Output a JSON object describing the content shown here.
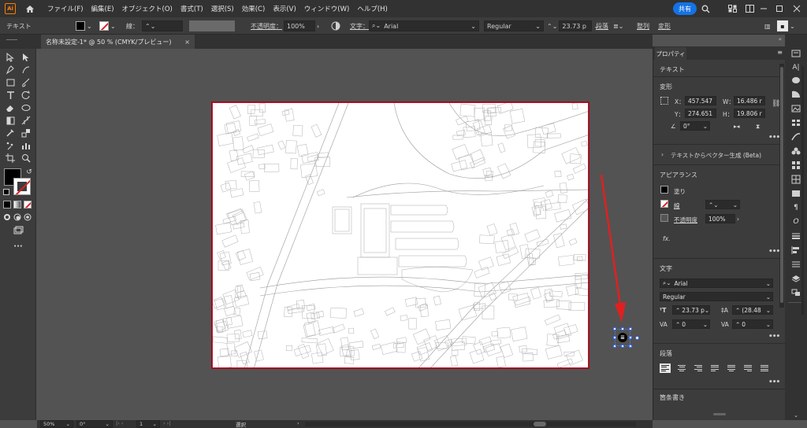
{
  "app": {
    "logo": "Ai",
    "menu": [
      "ファイル(F)",
      "編集(E)",
      "オブジェクト(O)",
      "書式(T)",
      "選択(S)",
      "効果(C)",
      "表示(V)",
      "ウィンドウ(W)",
      "ヘルプ(H)"
    ],
    "share_label": "共有"
  },
  "control_bar": {
    "mode_label": "テキスト",
    "stroke_label": "線：",
    "opacity_label": "不透明度：",
    "opacity_value": "100%",
    "char_label": "文字：",
    "font_value": "Arial",
    "style_value": "Regular",
    "size_value": "23.73 p",
    "paragraph_label": "段落",
    "align_label": "整列",
    "transform_label": "変形"
  },
  "document": {
    "tab_title": "名称未設定-1* @ 50 % (CMYK/プレビュー)",
    "close_symbol": "×"
  },
  "status": {
    "zoom": "50%",
    "rotation": "0°",
    "artboard_num": "1",
    "tool_label": "選択"
  },
  "properties": {
    "tab_label": "プロパティ",
    "type_label": "テキスト",
    "transform": {
      "heading": "変形",
      "x_label": "X：",
      "x_value": "457.547",
      "y_label": "Y：",
      "y_value": "274.651",
      "w_label": "W：",
      "w_value": "16.486 r",
      "h_label": "H：",
      "h_value": "19.806 r",
      "angle_value": "0°"
    },
    "vector_gen": "テキストからベクター生成 (Beta)",
    "appearance": {
      "heading": "アピアランス",
      "fill_label": "塗り",
      "stroke_label": "線",
      "opacity_label": "不透明度",
      "opacity_value": "100%",
      "fx_label": "fx."
    },
    "character": {
      "heading": "文字",
      "font_value": "Arial",
      "style_value": "Regular",
      "size_value": "23.73 p",
      "leading_value": "(28.48",
      "kerning_value": "0",
      "tracking_value": "0"
    },
    "paragraph": {
      "heading": "段落"
    },
    "bullets_heading": "箇条書き"
  },
  "colors": {
    "accent": "#1473e6",
    "arrow": "#e02020",
    "artboard_border": "#c8102e"
  }
}
